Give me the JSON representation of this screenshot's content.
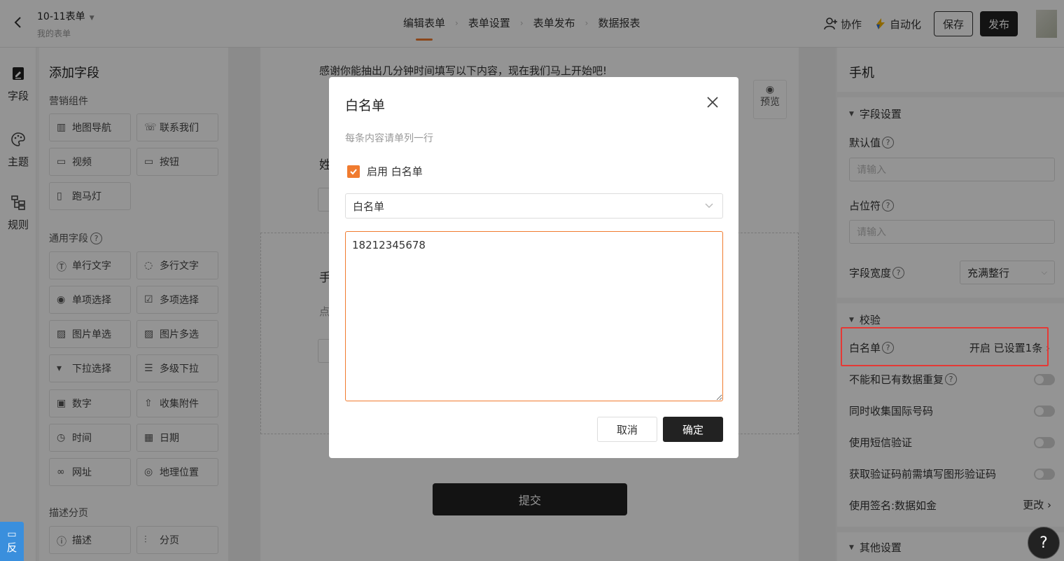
{
  "header": {
    "form_title": "10-11表单",
    "form_subtitle": "我的表单",
    "steps": [
      "编辑表单",
      "表单设置",
      "表单发布",
      "数据报表"
    ],
    "collaborate": "协作",
    "automation": "自动化",
    "save": "保存",
    "publish": "发布"
  },
  "rail": {
    "fields": "字段",
    "theme": "主题",
    "rules": "规则"
  },
  "fields_panel": {
    "title": "添加字段",
    "marketing_label": "营销组件",
    "marketing": [
      "地图导航",
      "联系我们",
      "视频",
      "按钮",
      "跑马灯"
    ],
    "general_label": "通用字段",
    "general": [
      "单行文字",
      "多行文字",
      "单项选择",
      "多项选择",
      "图片单选",
      "图片多选",
      "下拉选择",
      "多级下拉",
      "数字",
      "收集附件",
      "时间",
      "日期",
      "网址",
      "地理位置"
    ],
    "desc_label": "描述分页",
    "desc": [
      "描述",
      "分页"
    ]
  },
  "canvas": {
    "welcome": "感谢你能抽出几分钟时间填写以下内容，现在我们马上开始吧!",
    "field_a": "姓",
    "field_b": "手",
    "field_b_hint": "点",
    "preview": "预览",
    "submit": "提交"
  },
  "right_panel": {
    "title": "手机",
    "field_settings": "字段设置",
    "default_value_label": "默认值",
    "default_value_placeholder": "请输入",
    "placeholder_label": "占位符",
    "placeholder_placeholder": "请输入",
    "width_label": "字段宽度",
    "width_value": "充满整行",
    "validation": "校验",
    "whitelist_label": "白名单",
    "whitelist_status": "开启 已设置1条",
    "no_duplicate": "不能和已有数据重复",
    "intl_number": "同时收集国际号码",
    "sms_verify": "使用短信验证",
    "captcha": "获取验证码前需填写图形验证码",
    "signature_label": "使用签名:数据如金",
    "signature_action": "更改",
    "other_settings": "其他设置"
  },
  "modal": {
    "title": "白名单",
    "hint": "每条内容请单列一行",
    "enable_label": "启用 白名单",
    "enable_checked": true,
    "select_value": "白名单",
    "textarea_value": "18212345678",
    "cancel": "取消",
    "confirm": "确定"
  },
  "floating": {
    "feedback": "反",
    "help": "?"
  },
  "colors": {
    "accent": "#f07b2f",
    "dark": "#222222",
    "highlight": "#e53935",
    "feedback": "#3a8fdd"
  }
}
